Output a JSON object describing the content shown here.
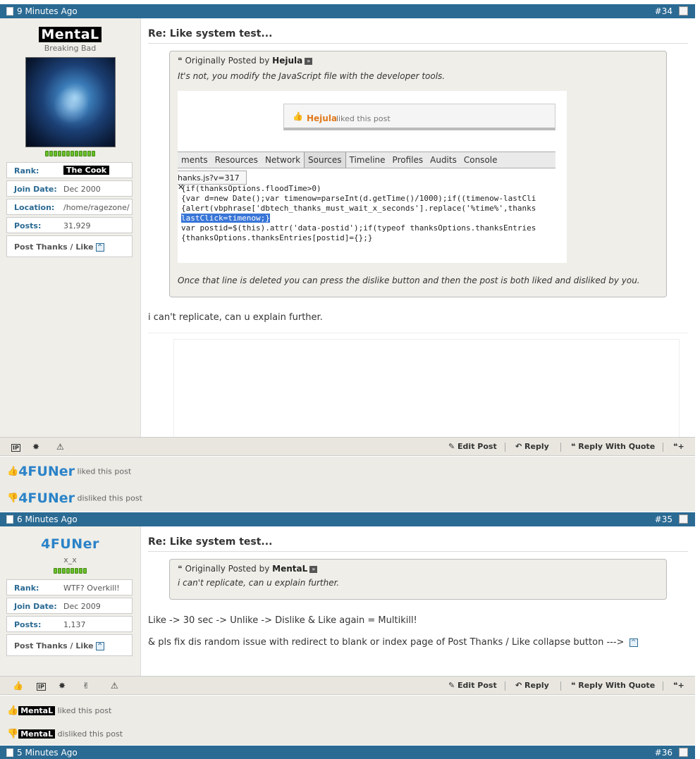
{
  "posts": [
    {
      "time": "9 Minutes Ago",
      "number": "#34",
      "user": {
        "name": "MentaL",
        "title": "Breaking Bad",
        "rank_label": "Rank:",
        "rank": "The Cook",
        "join_label": "Join Date:",
        "join": "Dec 2000",
        "location_label": "Location:",
        "location": "/home/ragezone/",
        "posts_label": "Posts:",
        "posts": "31,929",
        "thanks_label": "Post Thanks / Like"
      },
      "title": "Re: Like system test...",
      "quote": {
        "prefix": "Originally Posted by",
        "author": "Hejula",
        "text": "It's not, you modify the JavaScript file with the developer tools.",
        "after": "Once that line is deleted you can press the dislike button and then the post is both liked and disliked by you."
      },
      "embed": {
        "liked_name": "Hejula",
        "liked_text": "liked this post",
        "tabs": [
          "ments",
          "Resources",
          "Network",
          "Sources",
          "Timeline",
          "Profiles",
          "Audits",
          "Console"
        ],
        "file_tab": "hanks.js?v=317 ✕",
        "code": [
          "{if(thanksOptions.floodTime>0)",
          "{var d=new Date();var timenow=parseInt(d.getTime()/1000);if((timenow-lastCli",
          "{alert(vbphrase['dbtech_thanks_must_wait_x_seconds'].replace('%time%',thanks",
          "lastClick=timenow;}",
          "var postid=$(this).attr('data-postid');if(typeof thanksOptions.thanksEntries",
          "{thanksOptions.thanksEntries[postid]={};}"
        ]
      },
      "body": "i can't replicate, can u explain further."
    },
    {
      "time": "6 Minutes Ago",
      "number": "#35",
      "user": {
        "name": "4FUNer",
        "title": "x_x",
        "rank_label": "Rank:",
        "rank": "WTF? Overkill!",
        "join_label": "Join Date:",
        "join": "Dec 2009",
        "posts_label": "Posts:",
        "posts": "1,137",
        "thanks_label": "Post Thanks / Like"
      },
      "title": "Re: Like system test...",
      "quote": {
        "prefix": "Originally Posted by",
        "author": "MentaL",
        "text": "i can't replicate, can u explain further."
      },
      "body1": "Like -> 30 sec -> Unlike -> Dislike & Like again = Multikill!",
      "body2": "& pls fix dis random issue with redirect to blank or index page of Post Thanks / Like collapse button --->"
    },
    {
      "time": "5 Minutes Ago",
      "number": "#36"
    }
  ],
  "footer": {
    "edit": "Edit Post",
    "reply": "Reply",
    "reply_quote": "Reply With Quote",
    "ip": "IP"
  },
  "likes34": [
    {
      "name": "4FUNer",
      "text": "liked this post"
    },
    {
      "name": "4FUNer",
      "text": "disliked this post"
    }
  ],
  "likes35": [
    {
      "name": "MentaL",
      "text": "liked this post"
    },
    {
      "name": "MentaL",
      "text": "disliked this post"
    }
  ]
}
